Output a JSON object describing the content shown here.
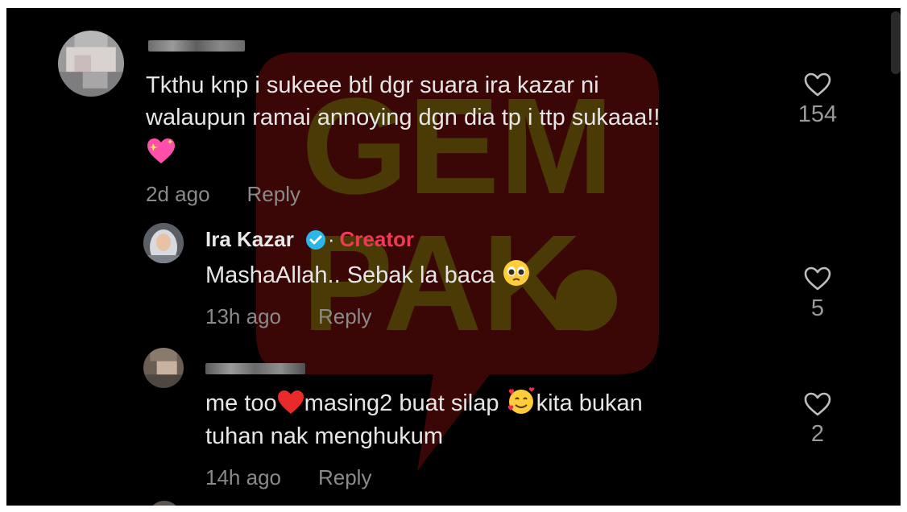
{
  "comments": [
    {
      "text_line1": "Tkthu knp i sukeee btl dgr suara ira kazar ni",
      "text_line2": "walaupun ramai annoying dgn dia tp i ttp sukaaa!!",
      "time": "2d ago",
      "reply_label": "Reply",
      "likes": "154",
      "emoji": "sparkling-heart"
    }
  ],
  "replies": [
    {
      "author": "Ira Kazar",
      "separator": "·",
      "badge": "Creator",
      "text_line1": "MashaAllah.. Sebak la baca",
      "time": "13h ago",
      "reply_label": "Reply",
      "likes": "5",
      "emoji": "pleading-face"
    },
    {
      "text_line1a": "me too",
      "text_line1b": "masing2 buat silap",
      "text_line1c": "kita bukan",
      "text_line2": "tuhan nak menghukum",
      "time": "14h ago",
      "reply_label": "Reply",
      "likes": "2",
      "emoji": [
        "red-heart",
        "smiling-face-with-hearts"
      ]
    }
  ],
  "watermark": {
    "line1": "GEM",
    "line2": "PAK",
    "color": "#c41a1a"
  },
  "colors": {
    "background": "#000000",
    "creator": "#ee3a55",
    "verified": "#2bb5e8",
    "meta": "#8a8a8a"
  }
}
